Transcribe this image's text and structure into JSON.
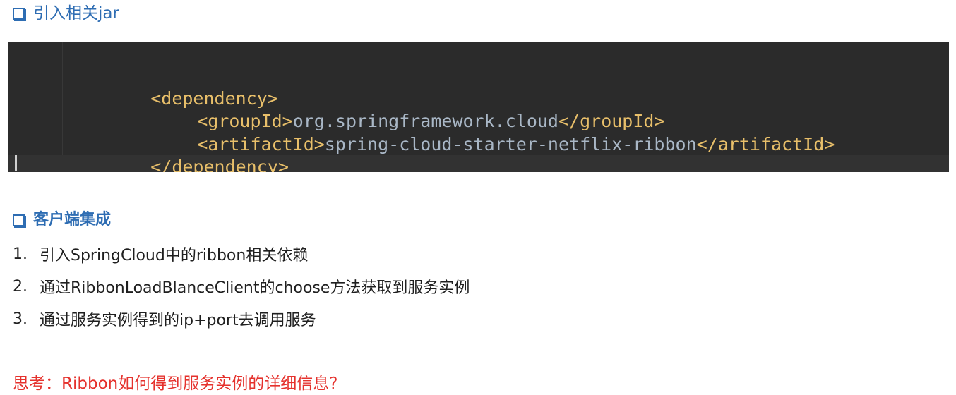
{
  "section1": {
    "title": "引入相关jar"
  },
  "code": {
    "line1": {
      "open": "<dependency>"
    },
    "line2": {
      "open": "<groupId>",
      "value": "org.springframework.cloud",
      "close": "</groupId>"
    },
    "line3": {
      "open": "<artifactId>",
      "value": "spring-cloud-starter-netflix-ribbon",
      "close": "</artifactId>"
    },
    "line4": {
      "close": "</dependency>"
    }
  },
  "section2": {
    "title": "客户端集成",
    "items": [
      {
        "num": "1.",
        "text": "引入SpringCloud中的ribbon相关依赖"
      },
      {
        "num": "2.",
        "text": "通过RibbonLoadBlanceClient的choose方法获取到服务实例"
      },
      {
        "num": "3.",
        "text": "通过服务实例得到的ip+port去调用服务"
      }
    ]
  },
  "question": "思考：Ribbon如何得到服务实例的详细信息?",
  "colors": {
    "heading": "#2e6db3",
    "question": "#e5322d",
    "code_bg": "#2b2b2b",
    "code_tag": "#e8bf6a",
    "code_text": "#a9b7c6"
  }
}
